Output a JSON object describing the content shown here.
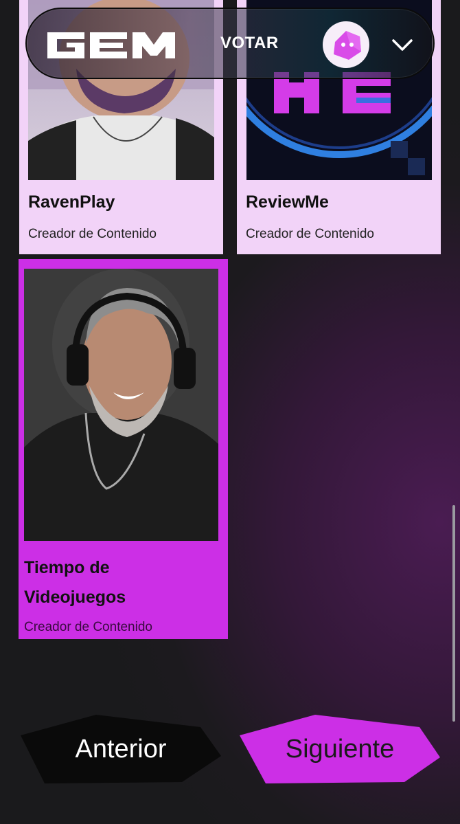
{
  "header": {
    "logo_text": "GEM",
    "vote_label": "VOTAR"
  },
  "cards": [
    {
      "name": "RavenPlay",
      "role": "Creador de Contenido"
    },
    {
      "name": "ReviewMe",
      "role": "Creador de Contenido",
      "logo_text": "Review Me"
    },
    {
      "name_line1": "Tiempo de",
      "name_line2": "Videojuegos",
      "role": "Creador de Contenido"
    }
  ],
  "nav": {
    "prev_label": "Anterior",
    "next_label": "Siguiente"
  },
  "colors": {
    "accent": "#cc2fe6",
    "card_bg": "#f2d3f8"
  }
}
